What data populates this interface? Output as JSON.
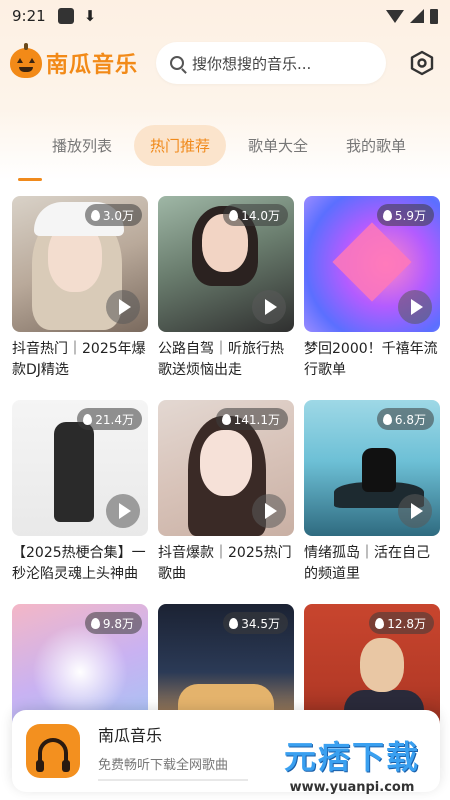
{
  "status_bar": {
    "time": "9:21"
  },
  "header": {
    "app_name": "南瓜音乐",
    "search_placeholder": "搜你想搜的音乐..."
  },
  "tabs": [
    {
      "label": "播放列表",
      "active": false
    },
    {
      "label": "热门推荐",
      "active": true
    },
    {
      "label": "歌单大全",
      "active": false
    },
    {
      "label": "我的歌单",
      "active": false
    }
  ],
  "playlists": [
    {
      "plays": "3.0万",
      "title": "抖音热门｜2025年爆款DJ精选"
    },
    {
      "plays": "14.0万",
      "title": "公路自驾｜听旅行热歌送烦恼出走"
    },
    {
      "plays": "5.9万",
      "title": "梦回2000！千禧年流行歌单"
    },
    {
      "plays": "21.4万",
      "title": "【2025热梗合集】一秒沦陷灵魂上头神曲"
    },
    {
      "plays": "141.1万",
      "title": "抖音爆款｜2025热门歌曲"
    },
    {
      "plays": "6.8万",
      "title": "情绪孤岛｜活在自己的频道里"
    },
    {
      "plays": "9.8万",
      "title": ""
    },
    {
      "plays": "34.5万",
      "title": ""
    },
    {
      "plays": "12.8万",
      "title": ""
    }
  ],
  "banner": {
    "title": "南瓜音乐",
    "subtitle": "免费畅听下载全网歌曲"
  },
  "watermark": {
    "logo": "元痞下载",
    "url": "www.yuanpi.com"
  },
  "colors": {
    "accent": "#f08a1c",
    "tab_active_bg": "#fbe4cc"
  }
}
